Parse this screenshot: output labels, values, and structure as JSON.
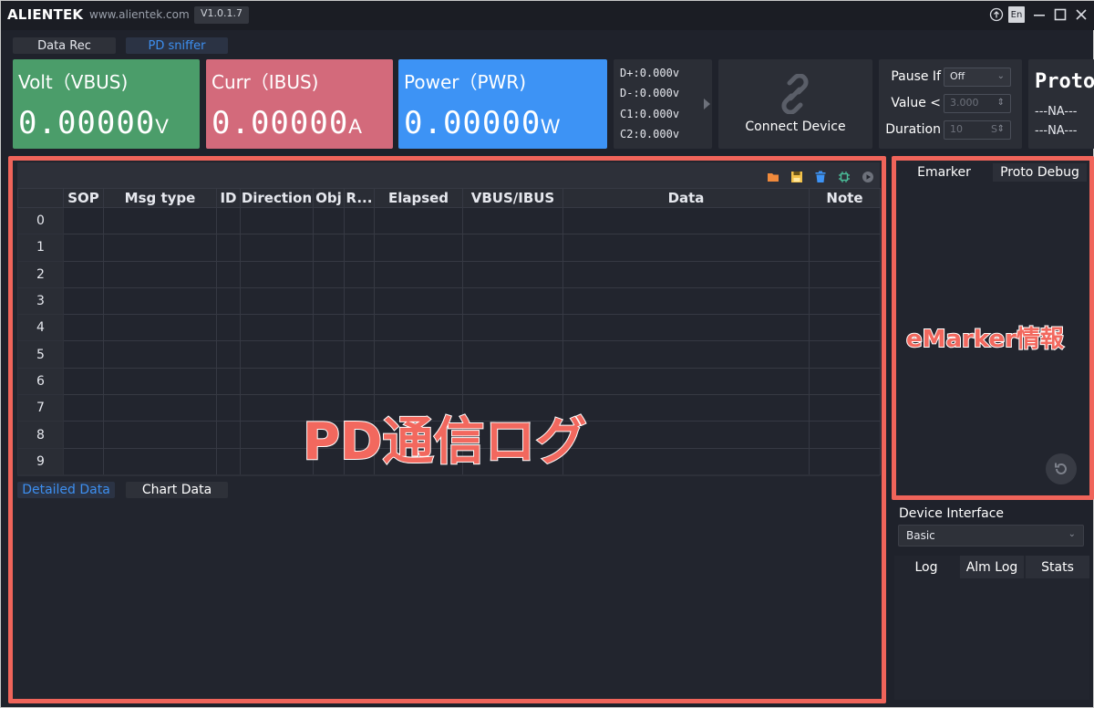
{
  "titlebar": {
    "brand": "ALIENTEK",
    "site": "www.alientek.com",
    "version": "V1.0.1.7",
    "lang": "En",
    "icons": [
      "upgrade-icon",
      "minimize-icon",
      "maximize-icon",
      "close-icon"
    ]
  },
  "mode_tabs": {
    "data_rec": "Data Rec",
    "pd_sniffer": "PD sniffer",
    "active_color": "#3d8ff0"
  },
  "meters": {
    "volt": {
      "label": "Volt（VBUS)",
      "value": "0.00000",
      "unit": "V",
      "color": "#4b9d6a"
    },
    "curr": {
      "label": "Curr（IBUS)",
      "value": "0.00000",
      "unit": "A",
      "color": "#d36a7b"
    },
    "power": {
      "label": "Power（PWR)",
      "value": "0.00000",
      "unit": "W",
      "color": "#3d93f5"
    }
  },
  "dlines": [
    {
      "label": "D+:",
      "value": "0.000",
      "unit": "v"
    },
    {
      "label": "D-:",
      "value": "0.000",
      "unit": "v"
    },
    {
      "label": "C1:",
      "value": "0.000",
      "unit": "v"
    },
    {
      "label": "C2:",
      "value": "0.000",
      "unit": "v"
    }
  ],
  "connect": {
    "label": "Connect Device"
  },
  "pause": {
    "pause_if_label": "Pause If",
    "pause_if_value": "Off",
    "value_label": "Value <",
    "value_value": "3.000",
    "duration_label": "Duration",
    "duration_value": "10",
    "duration_unit": "S"
  },
  "proto": {
    "title": "Proto",
    "na1": "---NA---",
    "na2": "---NA---"
  },
  "log_table": {
    "columns": [
      "",
      "SOP",
      "Msg type",
      "ID",
      "Direction",
      "Obj",
      "R...",
      "Elapsed",
      "VBUS/IBUS",
      "Data",
      "Note"
    ],
    "row_numbers": [
      "0",
      "1",
      "2",
      "3",
      "4",
      "5",
      "6",
      "7",
      "8",
      "9"
    ]
  },
  "bottom_tabs": {
    "detailed": "Detailed Data",
    "chart": "Chart Data"
  },
  "emarker_tabs": {
    "emarker": "Emarker",
    "proto_debug": "Proto Debug"
  },
  "device_interface": {
    "label": "Device Interface",
    "value": "Basic"
  },
  "log_tabs": {
    "log": "Log",
    "alm_log": "Alm Log",
    "stats": "Stats"
  },
  "annotations": {
    "main": "PD通信ログ",
    "side": "eMarker情報",
    "color": "#f0645a"
  }
}
